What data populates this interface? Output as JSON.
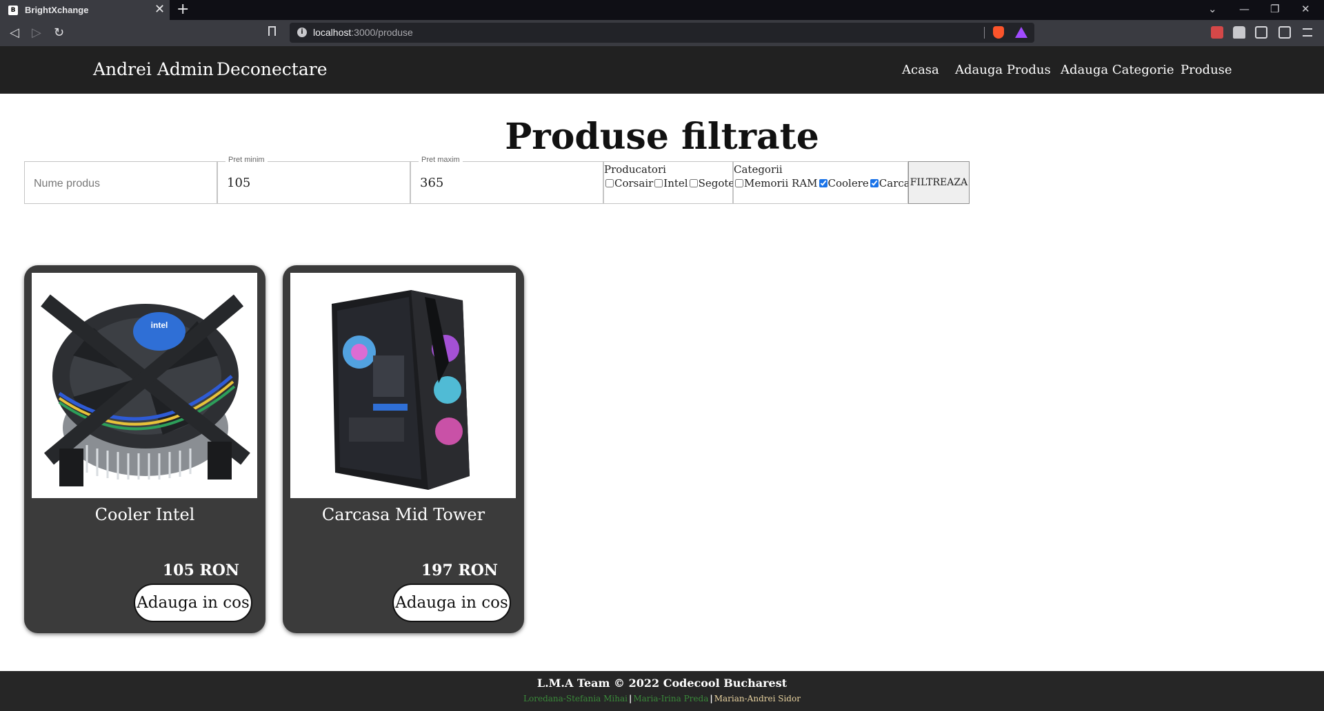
{
  "browser": {
    "tab_title": "BrightXchange",
    "tab_close": "✕",
    "new_tab": "+",
    "url_host": "localhost",
    "url_path": ":3000/produse",
    "window_controls": [
      "⌄",
      "—",
      "❐",
      "✕"
    ]
  },
  "navbar": {
    "user": "Andrei Admin",
    "logout": "Deconectare",
    "links": [
      "Acasa",
      "Adauga Produs",
      "Adauga Categorie",
      "Produse"
    ]
  },
  "main": {
    "title": "Produse filtrate",
    "filters": {
      "name_placeholder": "Nume produs",
      "min_price_label": "Pret minim",
      "min_price_value": "105",
      "max_price_label": "Pret maxim",
      "max_price_value": "365",
      "producers_label": "Producatori",
      "producers": [
        {
          "label": "Corsair",
          "checked": false
        },
        {
          "label": "Intel",
          "checked": false
        },
        {
          "label": "Segotep",
          "checked": false
        }
      ],
      "categories_label": "Categorii",
      "categories": [
        {
          "label": "Memorii RAM",
          "checked": false
        },
        {
          "label": "Coolere",
          "checked": true
        },
        {
          "label": "Carcase",
          "checked": true
        }
      ],
      "submit_label": "FILTREAZA"
    },
    "products": [
      {
        "name": "Cooler Intel",
        "price": "105 RON",
        "button": "Adauga in cos"
      },
      {
        "name": "Carcasa Mid Tower",
        "price": "197 RON",
        "button": "Adauga in cos"
      }
    ]
  },
  "footer": {
    "title": "L.M.A Team © 2022 Codecool Bucharest",
    "authors": [
      {
        "name": "Loredana-Stefania Mihai",
        "color": "#3a8a3a"
      },
      {
        "name": "Maria-Irina Preda",
        "color": "#3a8a3a"
      },
      {
        "name": "Marian-Andrei Sidor",
        "color": "#e9d3a0"
      }
    ]
  }
}
